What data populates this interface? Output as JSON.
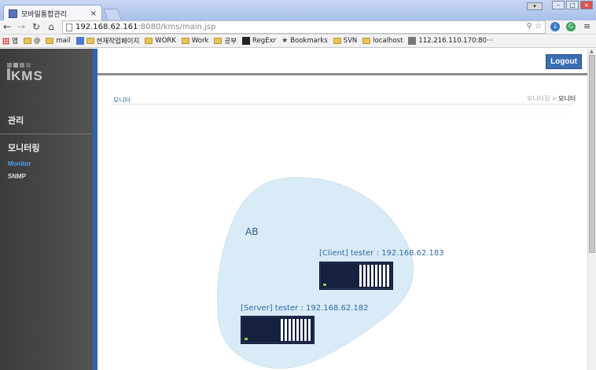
{
  "browser": {
    "tab_title": "모바일통합관리",
    "tab_close": "×",
    "url_host": "192.168.62.161",
    "url_path": ":8080/kms/main.jsp",
    "bookmarks": [
      {
        "label": "앱",
        "icon": "apps-icon"
      },
      {
        "label": "@",
        "icon": "none"
      },
      {
        "label": "mail",
        "icon": "folder-icon"
      },
      {
        "label": "현재작업페이지",
        "icon": "folder-icon"
      },
      {
        "label": "WORK",
        "icon": "folder-icon"
      },
      {
        "label": "Work",
        "icon": "folder-icon"
      },
      {
        "label": "공부",
        "icon": "folder-icon"
      },
      {
        "label": "RegExr",
        "icon": "regexr-icon"
      },
      {
        "label": "Bookmarks",
        "icon": "star-icon"
      },
      {
        "label": "SVN",
        "icon": "folder-icon"
      },
      {
        "label": "localhost",
        "icon": "folder-icon"
      },
      {
        "label": "112.216.110.170:80···",
        "icon": "page-icon"
      }
    ]
  },
  "sidebar": {
    "logo_text": "KMS",
    "heading_manage": "관리",
    "heading_monitoring": "모니터링",
    "links": [
      {
        "label": "Monitor",
        "active": true
      },
      {
        "label": "SNMP",
        "active": false
      }
    ]
  },
  "header": {
    "logout_label": "Logout"
  },
  "main": {
    "section_title": "모니터",
    "breadcrumb_prev": "모니터링",
    "breadcrumb_sep": ">",
    "breadcrumb_current": "모니터"
  },
  "topology": {
    "group_name": "AB",
    "group_color": "#d9ebf6",
    "client_label": "[Client]  tester : 192.168.62.183",
    "server_label": "[Server]  tester : 192.168.62.182"
  },
  "colors": {
    "accent": "#2f64b3",
    "logout": "#3b6db3",
    "active_link": "#4da2ee"
  }
}
